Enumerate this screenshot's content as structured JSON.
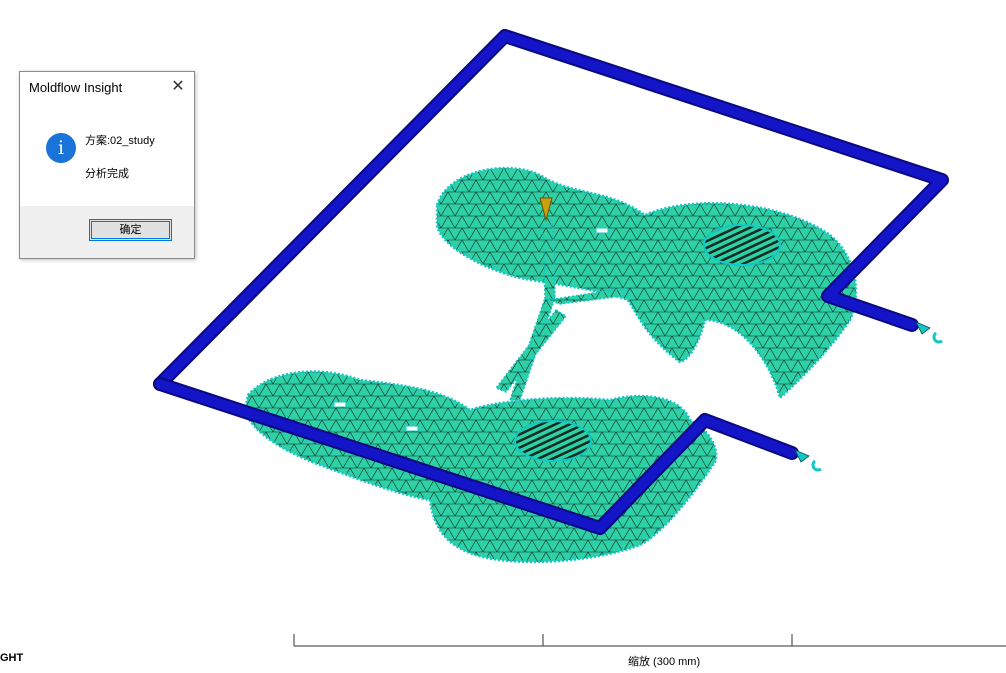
{
  "dialog": {
    "title": "Moldflow Insight",
    "close_icon": "close-icon",
    "info_icon": "info-icon",
    "line1": "方案:02_study",
    "line2": "分析完成",
    "ok_label": "确定"
  },
  "viewport": {
    "corner_text": "GHT",
    "scale_label": "缩放 (300 mm)",
    "colors": {
      "mesh": "#2ed1a6",
      "mesh_edge": "#0b2a22",
      "mesh_outline": "#11c7c7",
      "cooling_channel": "#1414c8",
      "gate": "#c8a010"
    }
  }
}
